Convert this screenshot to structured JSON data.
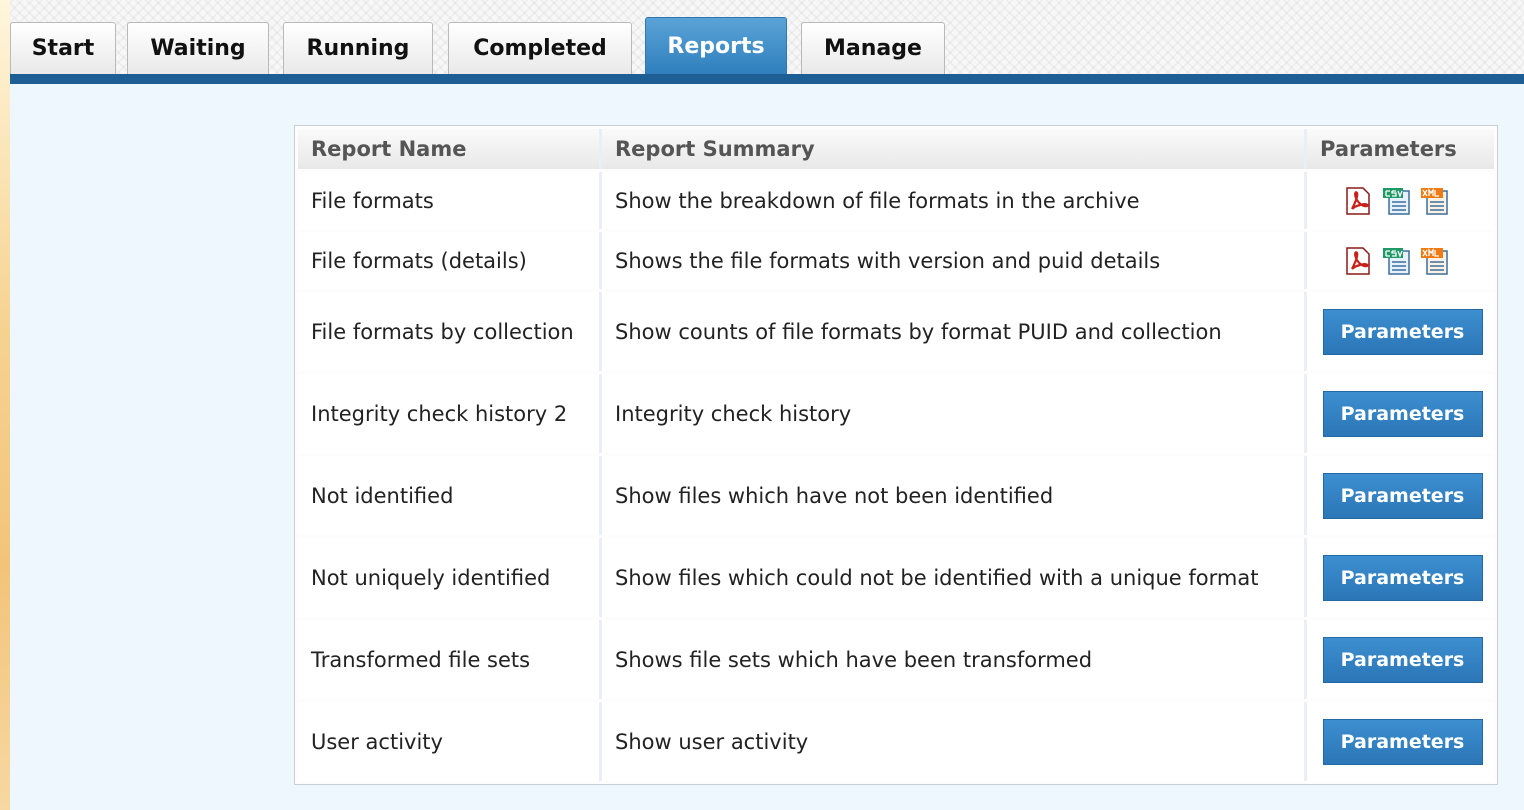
{
  "colors": {
    "tab_active": "#3584c4",
    "tab_border_line": "#1d5f95",
    "content_bg": "#eef6fe",
    "button": "#2f7fbe",
    "pdf_icon": "#c8201a",
    "csv_icon": "#1f9a67",
    "xml_icon": "#f07b12"
  },
  "tabs": [
    {
      "label": "Start",
      "active": false
    },
    {
      "label": "Waiting",
      "active": false
    },
    {
      "label": "Running",
      "active": false
    },
    {
      "label": "Completed",
      "active": false
    },
    {
      "label": "Reports",
      "active": true
    },
    {
      "label": "Manage",
      "active": false
    }
  ],
  "table": {
    "headers": [
      "Report Name",
      "Report Summary",
      "Parameters"
    ],
    "rows": [
      {
        "name": "File formats",
        "summary": "Show the breakdown of file formats in the archive",
        "param_type": "icons",
        "icons": [
          "pdf-icon",
          "csv-icon",
          "xml-icon"
        ]
      },
      {
        "name": "File formats (details)",
        "summary": "Shows the file formats with version and puid details",
        "param_type": "icons",
        "icons": [
          "pdf-icon",
          "csv-icon",
          "xml-icon"
        ]
      },
      {
        "name": "File formats by collection",
        "summary": "Show counts of file formats by format PUID and collection",
        "param_type": "button",
        "button_label": "Parameters"
      },
      {
        "name": "Integrity check history 2",
        "summary": "Integrity check history",
        "param_type": "button",
        "button_label": "Parameters"
      },
      {
        "name": "Not identified",
        "summary": "Show files which have not been identified",
        "param_type": "button",
        "button_label": "Parameters"
      },
      {
        "name": "Not uniquely identified",
        "summary": "Show files which could not be identified with a unique format",
        "param_type": "button",
        "button_label": "Parameters"
      },
      {
        "name": "Transformed file sets",
        "summary": "Shows file sets which have been transformed",
        "param_type": "button",
        "button_label": "Parameters"
      },
      {
        "name": "User activity",
        "summary": "Show user activity",
        "param_type": "button",
        "button_label": "Parameters"
      }
    ]
  }
}
